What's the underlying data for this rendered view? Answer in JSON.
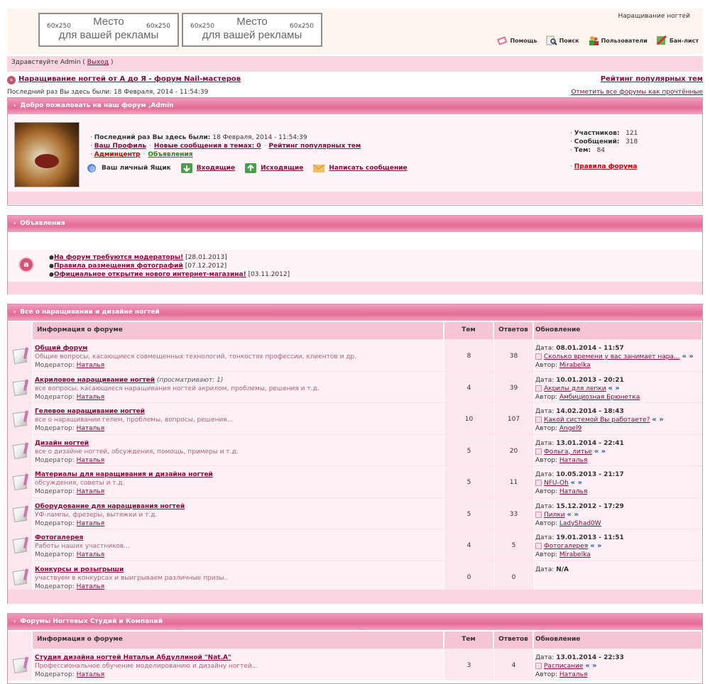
{
  "header": {
    "ads": [
      {
        "size": "60x250",
        "line1": "Место",
        "line2": "для вашей рекламы"
      },
      {
        "size": "60x250",
        "line1": "Место",
        "line2": "для вашей рекламы"
      }
    ],
    "site_title": "Наращивание ногтей",
    "toplinks": [
      {
        "label": "Помощь",
        "icon": "help-icon"
      },
      {
        "label": "Поиск",
        "icon": "search-icon"
      },
      {
        "label": "Пользователи",
        "icon": "users-icon"
      },
      {
        "label": "Бан-лист",
        "icon": "banlist-icon"
      }
    ]
  },
  "greeting": {
    "prefix": "Здравствуйте Admin (",
    "logout": "Выход",
    "suffix": ")"
  },
  "breadcrumb": {
    "forum_link": "Наращивание ногтей от А до Я - форум Nail-мастеров",
    "right_link": "Рейтинг популярных тем"
  },
  "last_visit": {
    "text": "Последний раз Вы здесь были: 18 Февраля, 2014 - 11:54:39",
    "mark_read": "Отметить все форумы как прочтённые"
  },
  "welcome": {
    "title": "Добро пожаловать на наш форум ,Admin",
    "last_visit_label": "Последний раз Вы здесь были:",
    "last_visit_value": "18 Февраля, 2014 - 11:54:39",
    "links1": [
      "Ваш Профиль",
      "Новые сообщения в темах: 0",
      "Рейтинг популярных тем"
    ],
    "admin_link": "Админцентр",
    "announce_link": "Объявления",
    "mailbox_label": "Ваш личный Ящик",
    "inbox": "Входящие",
    "outbox": "Исходящие",
    "compose": "Написать сообщение",
    "stats": [
      {
        "label": "Участников:",
        "value": "121"
      },
      {
        "label": "Сообщений:",
        "value": "318"
      },
      {
        "label": "Тем:",
        "value": "84"
      }
    ],
    "rules": "Правила форума"
  },
  "announcements": {
    "title": "Объявления",
    "items": [
      {
        "title": "На форум требуются модераторы!",
        "date": "[28.01.2013]"
      },
      {
        "title": "Правила размещения фотографий",
        "date": "[07.12.2012]"
      },
      {
        "title": "Официальное открытие нового интернет-магазина!",
        "date": "[03.11.2012]"
      }
    ]
  },
  "columns": {
    "info": "Информация о форуме",
    "topics": "Тем",
    "replies": "Ответов",
    "updated": "Обновление"
  },
  "category1": {
    "title": "Все о наращивании и дизайне ногтей",
    "forums": [
      {
        "name": "Общий форум",
        "viewing": "",
        "desc": "Общие вопросы, касающиеся совмещенных технологий, тонкостях профессии, клиентов и др.",
        "mod_label": "Модератор:",
        "mod": "Наталья",
        "topics": "8",
        "replies": "38",
        "date_label": "Дата:",
        "date": "08.01.2014 - 11:57",
        "last": "Сколько времени у вас занимает нара...",
        "arrows": "« »",
        "author_label": "Автор:",
        "author": "Mirabelka"
      },
      {
        "name": "Акриловое наращивание ногтей",
        "viewing": "(просматривают: 1)",
        "desc": "все вопросы, касающиеся наращивания ногтей акрилом, проблемы, решения и т.д.",
        "mod_label": "Модератор:",
        "mod": "Наталья",
        "topics": "4",
        "replies": "39",
        "date_label": "Дата:",
        "date": "10.01.2013 - 20:21",
        "last": "Акрилы для лепки",
        "arrows": "« »",
        "author_label": "Автор:",
        "author": "Амбициозная Брюнетка"
      },
      {
        "name": "Гелевое наращивание ногтей",
        "viewing": "",
        "desc": "все о наращивании гелем, проблемы, вопросы, решения...",
        "mod_label": "Модератор:",
        "mod": "Наталья",
        "topics": "10",
        "replies": "107",
        "date_label": "Дата:",
        "date": "14.02.2014 - 18:43",
        "last": "Какой системой Вы работаете?",
        "arrows": "« »",
        "author_label": "Автор:",
        "author": "Angel9"
      },
      {
        "name": "Дизайн ногтей",
        "viewing": "",
        "desc": "все о дизайне ногтей, обсуждения, помощь, примеры и т.д.",
        "mod_label": "Модератор:",
        "mod": "Наталья",
        "topics": "5",
        "replies": "20",
        "date_label": "Дата:",
        "date": "13.01.2014 - 22:41",
        "last": "Фольга, литье",
        "arrows": "« »",
        "author_label": "Автор:",
        "author": "Наталья"
      },
      {
        "name": "Материалы для наращивания и дизайна ногтей",
        "viewing": "",
        "desc": "обсуждения, советы и т.д.",
        "mod_label": "Модератор:",
        "mod": "Наталья",
        "topics": "5",
        "replies": "11",
        "date_label": "Дата:",
        "date": "10.05.2013 - 21:17",
        "last": "NFU-Oh",
        "arrows": "« »",
        "author_label": "Автор:",
        "author": "Наталья"
      },
      {
        "name": "Оборудование для наращивания ногтей",
        "viewing": "",
        "desc": "УФ-лампы, фрезеры, вытяжки и т.д.",
        "mod_label": "Модератор:",
        "mod": "Наталья",
        "topics": "5",
        "replies": "33",
        "date_label": "Дата:",
        "date": "15.12.2012 - 17:29",
        "last": "Пилки",
        "arrows": "« »",
        "author_label": "Автор:",
        "author": "LadyShad0W"
      },
      {
        "name": "Фотогалерея",
        "viewing": "",
        "desc": "Работы наших участников...",
        "mod_label": "Модератор:",
        "mod": "Наталья",
        "topics": "4",
        "replies": "5",
        "date_label": "Дата:",
        "date": "19.01.2013 - 11:51",
        "last": "Фотогалерея",
        "arrows": "« »",
        "author_label": "Автор:",
        "author": "Mirabelka"
      },
      {
        "name": "Конкурсы и розыгрыши",
        "viewing": "",
        "desc": "участвуем в конкурсах и выигрываем различные призы..",
        "mod_label": "Модератор:",
        "mod": "Наталья",
        "topics": "0",
        "replies": "0",
        "date_label": "Дата:",
        "date": "N/A",
        "last": "",
        "arrows": "",
        "author_label": "",
        "author": ""
      }
    ]
  },
  "category2": {
    "title": "Форумы Ногтевых Студий и Компаний",
    "forums": [
      {
        "name": "Студия дизайна ногтей Натальи Абдуллиной \"Nat.A\"",
        "viewing": "",
        "desc": "Профессиональное обучение моделированию и дизайну ногтей...",
        "mod_label": "Модератор:",
        "mod": "Наталья",
        "topics": "3",
        "replies": "4",
        "date_label": "Дата:",
        "date": "13.01.2014 - 22:33",
        "last": "Расписание",
        "arrows": "« »",
        "author_label": "Автор:",
        "author": "Наталья"
      }
    ]
  },
  "colors": {
    "pink_head": "#e46b95",
    "light_pink": "#fad6e2",
    "link": "#8b0a3c",
    "admin": "#cc0000",
    "green": "#1a8a1a"
  }
}
